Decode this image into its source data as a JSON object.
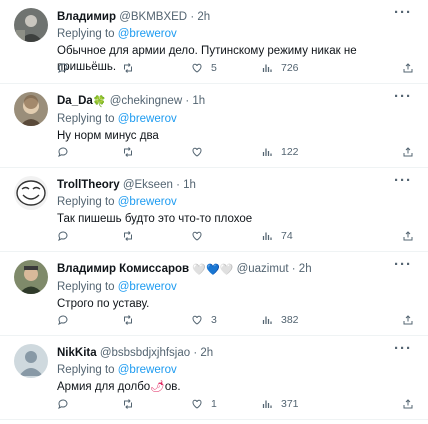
{
  "tweets": [
    {
      "name": "Владимир",
      "handle": "@BKMBXED",
      "time": "2h",
      "reply_prefix": "Replying to",
      "reply_to": "@brewerov",
      "text": "Обычное для армии дело. Путинскому режиму никак не пришьёшь.",
      "likes": "5",
      "views": "726"
    },
    {
      "name": "Da_Da",
      "badge": "🍀",
      "handle": "@chekingnew",
      "time": "1h",
      "reply_prefix": "Replying to",
      "reply_to": "@brewerov",
      "text": "Ну норм минус два",
      "likes": "",
      "views": "122"
    },
    {
      "name": "TrollTheory",
      "handle": "@Ekseen",
      "time": "1h",
      "reply_prefix": "Replying to",
      "reply_to": "@brewerov",
      "text": "Так пишешь будто это что-то плохое",
      "likes": "",
      "views": "74"
    },
    {
      "name": "Владимир Комиссаров",
      "badge": "🤍💙🤍",
      "handle": "@uazimut",
      "time": "2h",
      "reply_prefix": "Replying to",
      "reply_to": "@brewerov",
      "text": "Строго по уставу.",
      "likes": "3",
      "views": "382"
    },
    {
      "name": "NikKita",
      "handle": "@bsbsbdjxjhfsjao",
      "time": "2h",
      "reply_prefix": "Replying to",
      "reply_to": "@brewerov",
      "text_a": "Армия для долбо",
      "text_censor": "🌶",
      "text_b": "ов.",
      "likes": "1",
      "views": "371"
    }
  ],
  "dot": "·",
  "more": "···"
}
